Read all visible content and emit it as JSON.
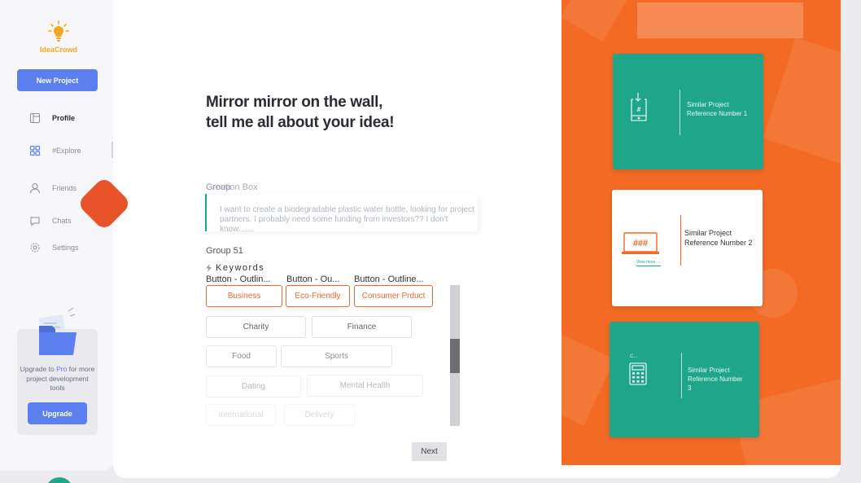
{
  "sidebar": {
    "logo_text": "IdeaCrowd",
    "new_project_label": "New Project",
    "nav": [
      {
        "label": "Profile",
        "icon": "profile-icon",
        "active": true
      },
      {
        "label": "#Explore",
        "icon": "grid-icon",
        "active": false
      },
      {
        "label": "Friends",
        "icon": "user-icon",
        "active": false
      },
      {
        "label": "Chats",
        "icon": "chat-icon",
        "active": false
      },
      {
        "label": "Settings",
        "icon": "gear-icon",
        "active": false
      }
    ],
    "upgrade": {
      "text_prefix": "Upgrade to ",
      "text_pro": "Pro",
      "text_suffix": " for more project development tools",
      "button_label": "Upgrade"
    }
  },
  "main": {
    "title": "Mirror mirror on the wall,\ntell me all about your idea!",
    "field_label_a": "Group",
    "field_label_b": "Creation Box",
    "idea_text": "I want to create a biodegradable plastic water bottle, looking for project partners. I probably need some funding from investors?? I don't know.......",
    "group_label": "Group 51",
    "keywords_label": "Keywords",
    "button_captions": [
      "Button - Outlin...",
      "Button - Ou...",
      "Button - Outline..."
    ],
    "chips": [
      {
        "label": "Business",
        "selected": true
      },
      {
        "label": "Eco-Friendly",
        "selected": true
      },
      {
        "label": "Consumer Prduct",
        "selected": true
      },
      {
        "label": "Charity",
        "selected": false
      },
      {
        "label": "Finance",
        "selected": false
      },
      {
        "label": "Food",
        "selected": false
      },
      {
        "label": "Sports",
        "selected": false
      },
      {
        "label": "Dating",
        "selected": false
      },
      {
        "label": "Mental Health",
        "selected": false
      },
      {
        "label": "International",
        "selected": false
      },
      {
        "label": "Delivery",
        "selected": false
      }
    ],
    "next_label": "Next"
  },
  "similar_projects": {
    "cards": [
      {
        "label": "Similar Project Reference Number 1",
        "icon": "phone-hash-icon",
        "style": "green"
      },
      {
        "label": "Similar Project Reference Number 2",
        "icon": "laptop-hash-icon",
        "style": "white",
        "view_more": "View more →"
      },
      {
        "label": "Similar Project Reference Number 3",
        "icon": "calculator-icon",
        "style": "green",
        "small_text": "C..."
      }
    ]
  },
  "colors": {
    "accent_blue": "#5b7fee",
    "orange": "#f26a24",
    "teal": "#1ea58a",
    "logo_yellow": "#f5a623"
  }
}
